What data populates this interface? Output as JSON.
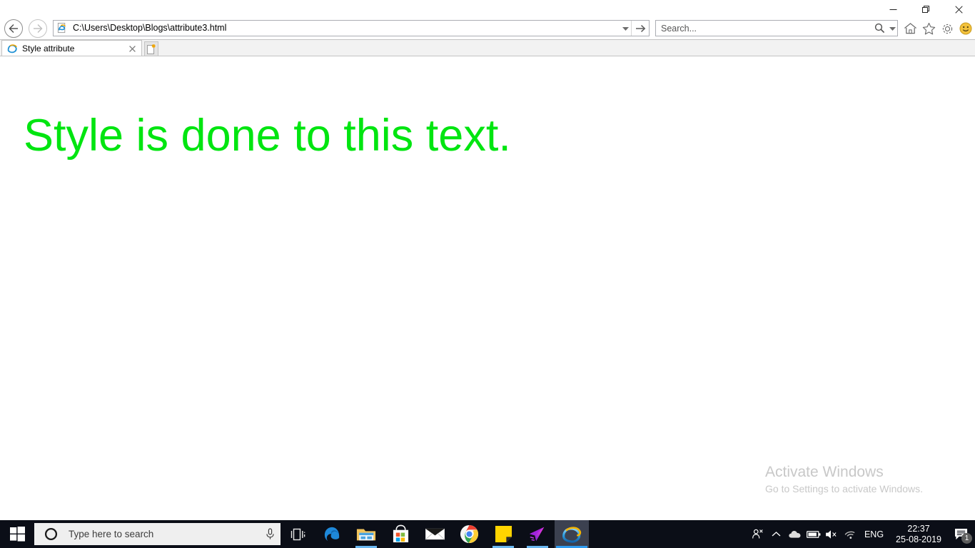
{
  "window": {
    "controls": {
      "minimize_label": "Minimize",
      "restore_label": "Restore",
      "close_label": "Close"
    }
  },
  "browser": {
    "name": "Internet Explorer",
    "back_label": "Back",
    "forward_label": "Forward",
    "address": {
      "value": "C:\\Users\\Desktop\\Blogs\\attribute3.html",
      "dropdown_label": "Address history",
      "go_label": "Go"
    },
    "search": {
      "placeholder": "Search...",
      "value": "",
      "dropdown_label": "Search provider"
    },
    "tool_icons": [
      {
        "name": "home-icon",
        "label": "Home"
      },
      {
        "name": "favorites-star-icon",
        "label": "View favorites, feeds, and history"
      },
      {
        "name": "gear-icon",
        "label": "Tools"
      },
      {
        "name": "smiley-feedback-icon",
        "label": "Send a Smile"
      }
    ],
    "tabs": [
      {
        "title": "Style attribute",
        "close_label": "Close tab",
        "active": true
      }
    ],
    "new_tab_label": "New tab"
  },
  "page": {
    "heading": "Style is done to this text.",
    "heading_color": "#00e510"
  },
  "watermark": {
    "title": "Activate Windows",
    "subtitle": "Go to Settings to activate Windows.",
    "color": "#c8c8c8"
  },
  "taskbar": {
    "start_label": "Start",
    "cortana": {
      "placeholder": "Type here to search",
      "value": "",
      "mic_label": "Search with voice"
    },
    "task_view_label": "Task View",
    "apps": [
      {
        "name": "microsoft-edge-icon",
        "label": "Microsoft Edge",
        "running": false,
        "active": false
      },
      {
        "name": "file-explorer-icon",
        "label": "File Explorer",
        "running": true,
        "active": false
      },
      {
        "name": "microsoft-store-icon",
        "label": "Microsoft Store",
        "running": false,
        "active": false
      },
      {
        "name": "mail-icon",
        "label": "Mail",
        "running": false,
        "active": false
      },
      {
        "name": "google-chrome-icon",
        "label": "Google Chrome",
        "running": true,
        "active": false
      },
      {
        "name": "sticky-notes-icon",
        "label": "Sticky Notes",
        "running": true,
        "active": false
      },
      {
        "name": "purple-arrow-app-icon",
        "label": "Arrow app",
        "running": true,
        "active": false
      },
      {
        "name": "internet-explorer-icon",
        "label": "Internet Explorer",
        "running": true,
        "active": true
      }
    ],
    "tray": {
      "icons": [
        {
          "name": "people-icon",
          "label": "People"
        },
        {
          "name": "show-hidden-icons-chevron",
          "label": "Show hidden icons"
        },
        {
          "name": "onedrive-cloud-icon",
          "label": "OneDrive"
        },
        {
          "name": "battery-icon",
          "label": "Battery"
        },
        {
          "name": "speaker-muted-icon",
          "label": "Volume muted"
        },
        {
          "name": "wifi-icon",
          "label": "Network"
        }
      ],
      "language": "ENG",
      "time": "22:37",
      "date": "25-08-2019",
      "action_center": {
        "label": "Notifications",
        "badge": "1"
      }
    }
  }
}
